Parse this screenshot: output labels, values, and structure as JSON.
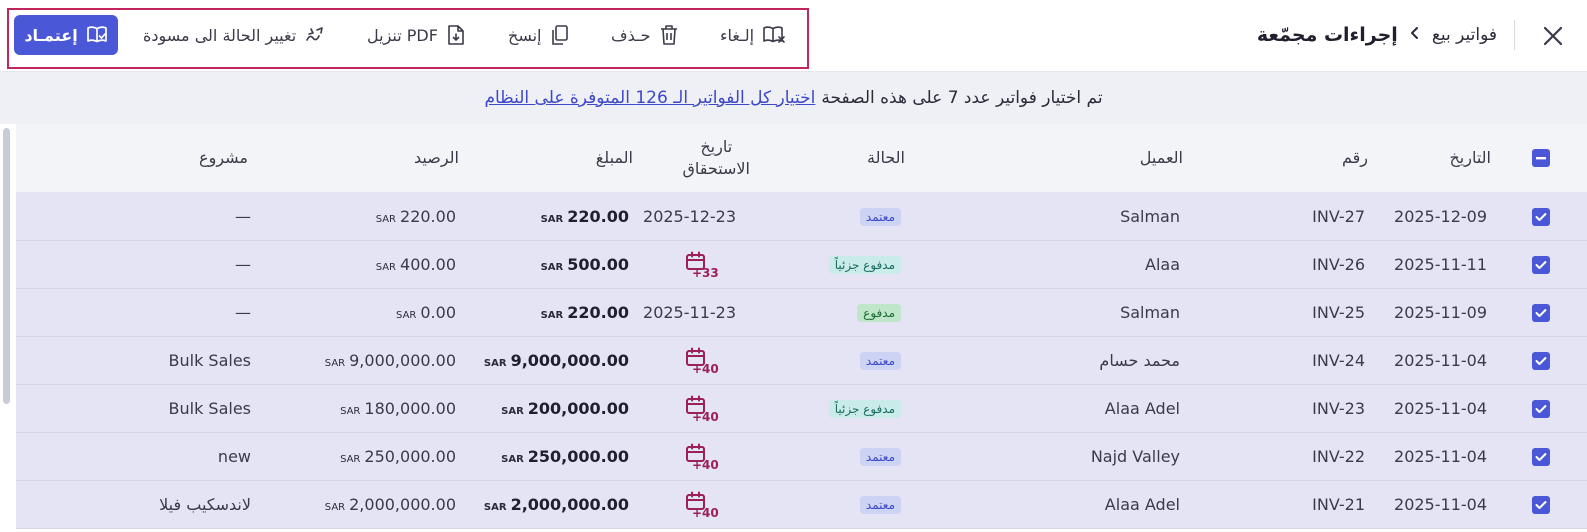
{
  "header": {
    "breadcrumb_parent": "فواتير بيع",
    "breadcrumb_title": "إجراءات مجمّعة"
  },
  "toolbar": {
    "approve_label": "إعتمـاد",
    "to_draft_label": "تغيير الحالة الى مسودة",
    "download_pdf_label": "تنزيل PDF",
    "copy_label": "إنسخ",
    "delete_label": "حـذف",
    "cancel_label": "إلـغاء"
  },
  "banner": {
    "text": "تم اختيار فواتير عدد 7 على هذه الصفحة",
    "link": "اختيار كل الفواتير الـ 126 المتوفرة على النظام"
  },
  "table": {
    "columns": {
      "date": "التاريخ",
      "number": "رقم",
      "customer": "العميل",
      "status": "الحالة",
      "due_date_line1": "تاريخ",
      "due_date_line2": "الاستحقاق",
      "amount": "المبلغ",
      "balance": "الرصيد",
      "project": "مشروع"
    },
    "currency": "SAR",
    "rows": [
      {
        "date": "2025-12-09",
        "number": "INV-27",
        "customer": "Salman",
        "status": "معتمد",
        "status_color": "blue",
        "due_date": "2025-12-23",
        "overdue_days": "",
        "amount": "220.00",
        "balance": "220.00",
        "project": "—"
      },
      {
        "date": "2025-11-11",
        "number": "INV-26",
        "customer": "Alaa",
        "status": "مدفوع جزئياً",
        "status_color": "teal",
        "due_date": "",
        "overdue_days": "+33",
        "amount": "500.00",
        "balance": "400.00",
        "project": "—"
      },
      {
        "date": "2025-11-09",
        "number": "INV-25",
        "customer": "Salman",
        "status": "مدفوع",
        "status_color": "green",
        "due_date": "2025-11-23",
        "overdue_days": "",
        "amount": "220.00",
        "balance": "0.00",
        "project": "—"
      },
      {
        "date": "2025-11-04",
        "number": "INV-24",
        "customer": "محمد حسام",
        "status": "معتمد",
        "status_color": "blue",
        "due_date": "",
        "overdue_days": "+40",
        "amount": "9,000,000.00",
        "balance": "9,000,000.00",
        "project": "Bulk Sales"
      },
      {
        "date": "2025-11-04",
        "number": "INV-23",
        "customer": "Alaa Adel",
        "status": "مدفوع جزئياً",
        "status_color": "teal",
        "due_date": "",
        "overdue_days": "+40",
        "amount": "200,000.00",
        "balance": "180,000.00",
        "project": "Bulk Sales"
      },
      {
        "date": "2025-11-04",
        "number": "INV-22",
        "customer": "Najd Valley",
        "status": "معتمد",
        "status_color": "blue",
        "due_date": "",
        "overdue_days": "+40",
        "amount": "250,000.00",
        "balance": "250,000.00",
        "project": "new"
      },
      {
        "date": "2025-11-04",
        "number": "INV-21",
        "customer": "Alaa Adel",
        "status": "معتمد",
        "status_color": "blue",
        "due_date": "",
        "overdue_days": "+40",
        "amount": "2,000,000.00",
        "balance": "2,000,000.00",
        "project": "لاندسكيب فيلا"
      }
    ]
  },
  "icons": {
    "close": "close-icon",
    "chevron": "chevron-left-icon",
    "approve": "book-check-icon",
    "to_draft": "draft-edit-icon",
    "download_pdf": "file-download-icon",
    "copy": "copy-icon",
    "delete": "trash-icon",
    "cancel": "book-x-icon",
    "overdue": "calendar-icon"
  },
  "colors": {
    "accent": "#4a57d6",
    "toolbar_highlight": "#c2245d",
    "selected_row": "#e5e4f5",
    "overdue": "#9b2059"
  }
}
